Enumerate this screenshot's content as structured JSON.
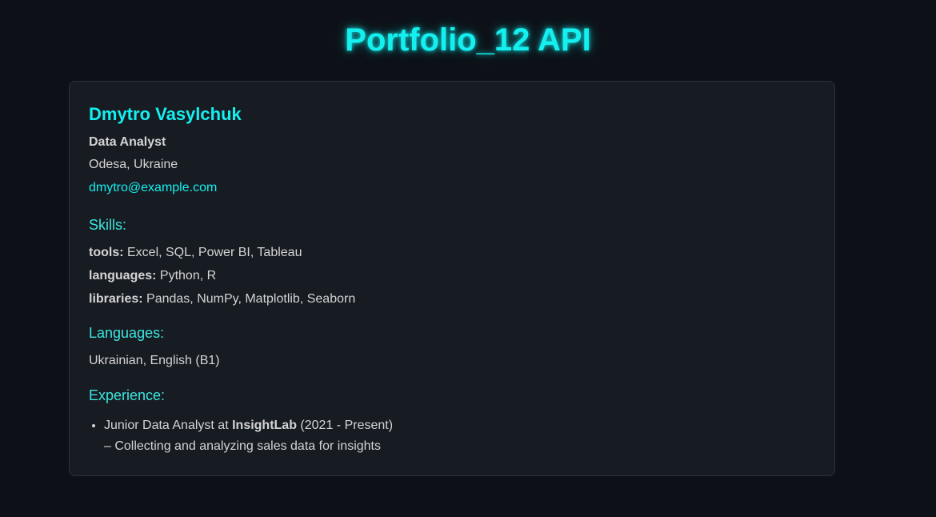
{
  "header": {
    "title": "Portfolio_12 API"
  },
  "profile": {
    "name": "Dmytro Vasylchuk",
    "role": "Data Analyst",
    "location": "Odesa, Ukraine",
    "email": "dmytro@example.com"
  },
  "skills": {
    "heading": "Skills:",
    "rows": [
      {
        "key": "tools:",
        "value": " Excel, SQL, Power BI, Tableau"
      },
      {
        "key": "languages:",
        "value": " Python, R"
      },
      {
        "key": "libraries:",
        "value": " Pandas, NumPy, Matplotlib, Seaborn"
      }
    ]
  },
  "languages": {
    "heading": "Languages:",
    "value": "Ukrainian, English (B1)"
  },
  "experience": {
    "heading": "Experience:",
    "items": [
      {
        "position_prefix": "Junior Data Analyst at ",
        "company": "InsightLab",
        "period": " (2021 - Present)",
        "description": "– Collecting and analyzing sales data for insights"
      }
    ]
  },
  "colors": {
    "background": "#0d1117",
    "card": "#171b22",
    "accent": "#14f0f0"
  }
}
